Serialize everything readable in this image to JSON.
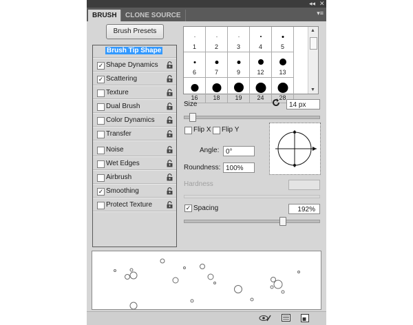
{
  "window": {
    "collapse_glyph": "◂◂",
    "close_glyph": "✕",
    "menu_glyph": "▾≡"
  },
  "tabs": [
    {
      "label": "BRUSH",
      "active": true
    },
    {
      "label": "CLONE SOURCE",
      "active": false
    }
  ],
  "presets_button": "Brush Presets",
  "options": [
    {
      "label": "Brush Tip Shape",
      "checkbox": false,
      "checked": false,
      "selected": true,
      "lock": false
    },
    {
      "label": "Shape Dynamics",
      "checkbox": true,
      "checked": true,
      "lock": true
    },
    {
      "label": "Scattering",
      "checkbox": true,
      "checked": true,
      "lock": true
    },
    {
      "label": "Texture",
      "checkbox": true,
      "checked": false,
      "lock": true
    },
    {
      "label": "Dual Brush",
      "checkbox": true,
      "checked": false,
      "lock": true
    },
    {
      "label": "Color Dynamics",
      "checkbox": true,
      "checked": false,
      "lock": true
    },
    {
      "label": "Transfer",
      "checkbox": true,
      "checked": false,
      "lock": true
    },
    {
      "label": "Noise",
      "checkbox": true,
      "checked": false,
      "lock": true
    },
    {
      "label": "Wet Edges",
      "checkbox": true,
      "checked": false,
      "lock": true
    },
    {
      "label": "Airbrush",
      "checkbox": true,
      "checked": false,
      "lock": true
    },
    {
      "label": "Smoothing",
      "checkbox": true,
      "checked": true,
      "lock": true
    },
    {
      "label": "Protect Texture",
      "checkbox": true,
      "checked": false,
      "lock": true
    }
  ],
  "brush_tips": [
    "1",
    "2",
    "3",
    "4",
    "5",
    "6",
    "7",
    "9",
    "12",
    "13",
    "16",
    "18",
    "19",
    "24",
    "28"
  ],
  "size": {
    "label": "Size",
    "value": "14 px",
    "reset_icon": "reset-icon",
    "slider_fraction": 0.06
  },
  "flip_x": {
    "label": "Flip X",
    "checked": false
  },
  "flip_y": {
    "label": "Flip Y",
    "checked": false
  },
  "angle": {
    "label": "Angle:",
    "value": "0°"
  },
  "roundness": {
    "label": "Roundness:",
    "value": "100%"
  },
  "hardness": {
    "label": "Hardness",
    "value": "",
    "disabled": true
  },
  "spacing": {
    "label": "Spacing",
    "checked": true,
    "value": "192%",
    "slider_fraction": 0.73
  },
  "bottom_icons": [
    "visibility-eye-icon",
    "brush-grid-icon",
    "new-preset-icon"
  ],
  "colors": {
    "panel_bg": "#d6d6d6",
    "selected": "#3399ff",
    "tab_bar": "#5a5a5a"
  }
}
